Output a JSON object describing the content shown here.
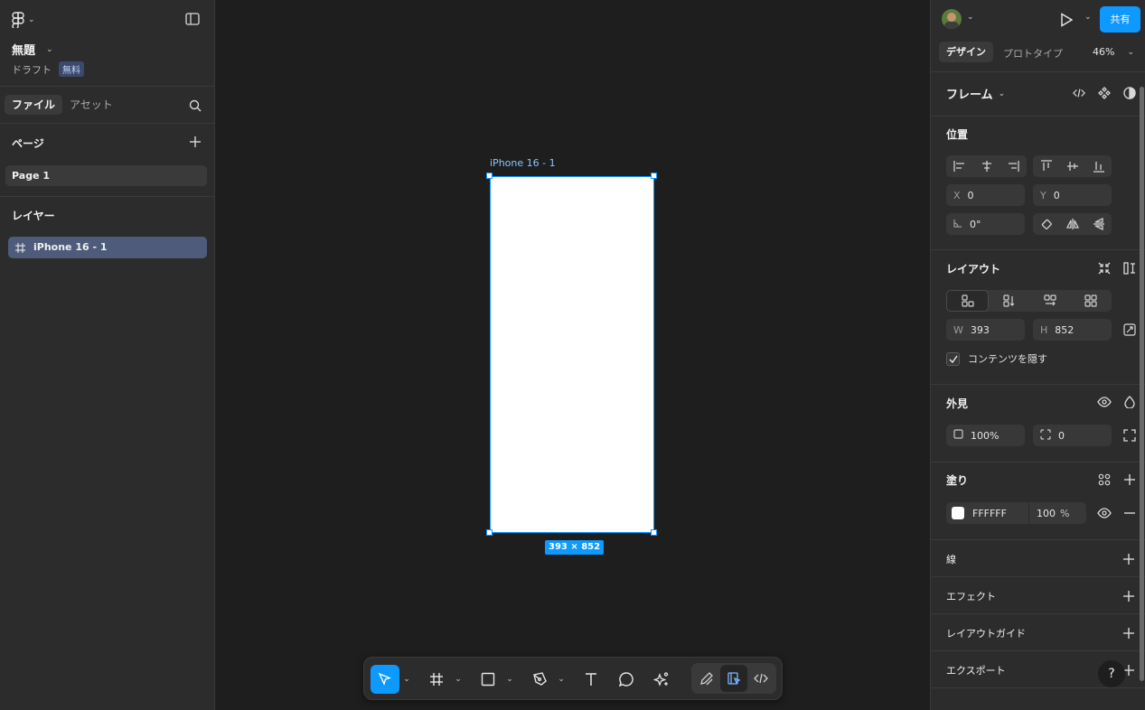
{
  "left_panel": {
    "file_title": "無題",
    "draft_label": "ドラフト",
    "plan_badge": "無料",
    "tabs": [
      {
        "label": "ファイル"
      },
      {
        "label": "アセット"
      }
    ],
    "pages_title": "ページ",
    "pages": [
      {
        "label": "Page 1"
      }
    ],
    "layers_title": "レイヤー",
    "layers": [
      {
        "label": "iPhone 16 - 1"
      }
    ]
  },
  "canvas": {
    "frame_label": "iPhone 16 - 1",
    "size_badge": "393 × 852"
  },
  "toolbar": {
    "tools": [
      "move-tool",
      "frame-tool",
      "shape-tool",
      "pen-tool",
      "text-tool",
      "comment-tool",
      "actions-tool"
    ],
    "modes": [
      "draw-mode",
      "design-mode",
      "dev-mode"
    ]
  },
  "right_panel": {
    "share_label": "共有",
    "tabs": [
      {
        "label": "デザイン"
      },
      {
        "label": "プロトタイプ"
      }
    ],
    "zoom": "46%",
    "frame_selector": "フレーム",
    "position": {
      "title": "位置",
      "x_label": "X",
      "x_value": "0",
      "y_label": "Y",
      "y_value": "0",
      "rotation": "0°"
    },
    "layout": {
      "title": "レイアウト",
      "w_label": "W",
      "w_value": "393",
      "h_label": "H",
      "h_value": "852",
      "clip_label": "コンテンツを隠す",
      "clip_checked": true
    },
    "appearance": {
      "title": "外見",
      "opacity": "100%",
      "radius": "0"
    },
    "fill": {
      "title": "塗り",
      "color_hex": "FFFFFF",
      "opacity": "100",
      "percent": "%"
    },
    "stroke_title": "線",
    "effects_title": "エフェクト",
    "layout_guide_title": "レイアウトガイド",
    "export_title": "エクスポート",
    "help_label": "?"
  },
  "colors": {
    "accent": "#0d99ff",
    "panel": "#2c2c2c",
    "canvas": "#1e1e1e",
    "selection": "#4e5b7a"
  }
}
